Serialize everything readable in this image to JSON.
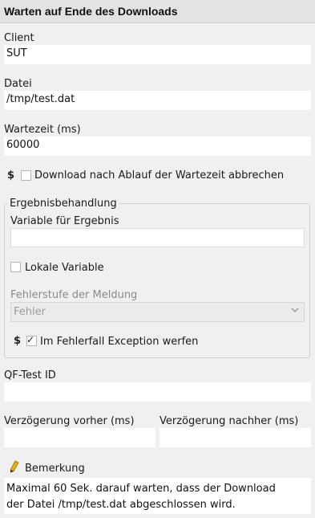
{
  "header": {
    "title": "Warten auf Ende des Downloads"
  },
  "client": {
    "label": "Client",
    "value": "SUT"
  },
  "file": {
    "label": "Datei",
    "value": "/tmp/test.dat"
  },
  "timeout": {
    "label": "Wartezeit (ms)",
    "value": "60000"
  },
  "abort_option": {
    "dollar": "$",
    "label": "Download nach Ablauf der Wartezeit abbrechen",
    "checked": false
  },
  "result_group": {
    "title": "Ergebnisbehandlung",
    "variable_label": "Variable für Ergebnis",
    "variable_value": "",
    "local_variable_label": "Lokale Variable",
    "local_variable_checked": false,
    "error_level_label": "Fehlerstufe der Meldung",
    "error_level_value": "Fehler",
    "exception_dollar": "$",
    "exception_label": "Im Fehlerfall Exception werfen",
    "exception_checked": true,
    "check_glyph": "✓"
  },
  "qftest_id": {
    "label": "QF-Test ID",
    "value": ""
  },
  "delay_before": {
    "label": "Verzögerung vorher (ms)",
    "value": ""
  },
  "delay_after": {
    "label": "Verzögerung nachher (ms)",
    "value": ""
  },
  "comment": {
    "label": "Bemerkung",
    "line1": "Maximal 60 Sek. darauf warten, dass der Download",
    "line2": "der Datei /tmp/test.dat abgeschlossen wird."
  },
  "colors": {
    "panel": "#f0f0f0",
    "header": "#e3e3e3",
    "field": "#ffffff",
    "pencil": "#e8b000"
  }
}
